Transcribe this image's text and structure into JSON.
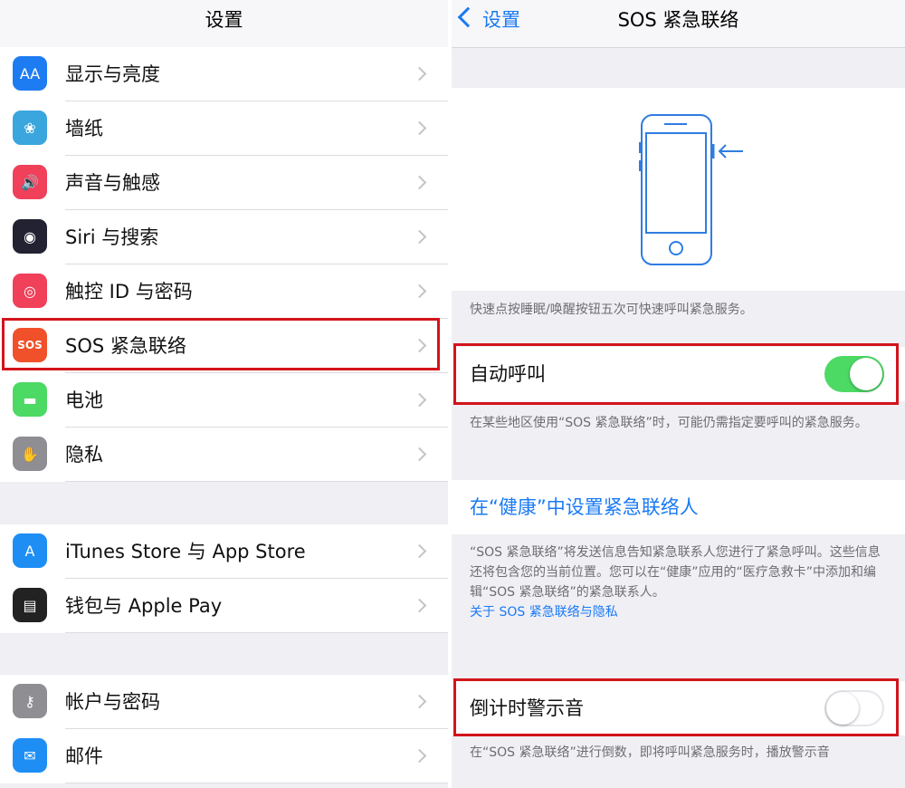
{
  "left": {
    "title": "设置",
    "items": [
      {
        "label": "显示与亮度",
        "icon": "display-brightness-icon",
        "glyph": "AA",
        "color": "#1e7cf2"
      },
      {
        "label": "墙纸",
        "icon": "wallpaper-icon",
        "glyph": "❀",
        "color": "#3aa6dd"
      },
      {
        "label": "声音与触感",
        "icon": "sound-icon",
        "glyph": "🔊",
        "color": "#f0405a"
      },
      {
        "label": "Siri 与搜索",
        "icon": "siri-icon",
        "glyph": "◉",
        "color": "#222233"
      },
      {
        "label": "触控 ID 与密码",
        "icon": "fingerprint-icon",
        "glyph": "◎",
        "color": "#f0405a"
      },
      {
        "label": "SOS 紧急联络",
        "icon": "sos-icon",
        "glyph": "SOS",
        "color": "#f0502a"
      },
      {
        "label": "电池",
        "icon": "battery-icon",
        "glyph": "▬",
        "color": "#4cd964"
      },
      {
        "label": "隐私",
        "icon": "privacy-hand-icon",
        "glyph": "✋",
        "color": "#8e8e93"
      },
      {
        "label": "iTunes Store 与 App Store",
        "icon": "app-store-icon",
        "glyph": "A",
        "color": "#1e8ef5"
      },
      {
        "label": "钱包与 Apple Pay",
        "icon": "wallet-icon",
        "glyph": "▤",
        "color": "#222222"
      },
      {
        "label": "帐户与密码",
        "icon": "key-icon",
        "glyph": "⚷",
        "color": "#8e8e93"
      },
      {
        "label": "邮件",
        "icon": "mail-icon",
        "glyph": "✉",
        "color": "#1e8ef5"
      }
    ]
  },
  "right": {
    "back_label": "设置",
    "title": "SOS 紧急联络",
    "illustration_note": "快速点按睡眠/唤醒按钮五次可快速呼叫紧急服务。",
    "auto_call": {
      "label": "自动呼叫",
      "on": true
    },
    "auto_call_note": "在某些地区使用“SOS 紧急联络”时，可能仍需指定要呼叫的紧急服务。",
    "health_link": "在“健康”中设置紧急联络人",
    "health_note": "“SOS 紧急联络”将发送信息告知紧急联系人您进行了紧急呼叫。这些信息还将包含您的当前位置。您可以在“健康”应用的“医疗急救卡”中添加和编辑“SOS 紧急联络”的紧急联系人。",
    "privacy_link": "关于 SOS 紧急联络与隐私",
    "countdown": {
      "label": "倒计时警示音",
      "on": false
    },
    "countdown_note": "在“SOS 紧急联络”进行倒数，即将呼叫紧急服务时，播放警示音"
  }
}
